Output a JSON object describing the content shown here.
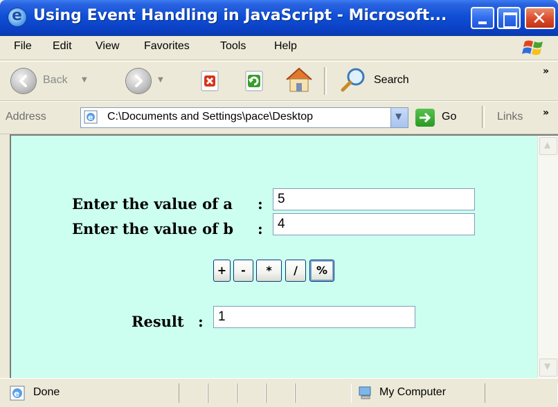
{
  "window": {
    "title": "Using Event Handling in JavaScript - Microsoft...",
    "title_bar_color": "#0a46d6"
  },
  "menu": {
    "file": "File",
    "edit": "Edit",
    "view": "View",
    "favorites": "Favorites",
    "tools": "Tools",
    "help": "Help"
  },
  "toolbar": {
    "back_label": "Back",
    "search_label": "Search",
    "more": "»"
  },
  "address": {
    "label": "Address",
    "value": "C:\\Documents and Settings\\pace\\Desktop",
    "go_label": "Go",
    "links_label": "Links",
    "more": "»"
  },
  "page": {
    "background": "#ccfff0",
    "label_a": "Enter the value of a",
    "label_b": "Enter the value of b",
    "colon": ":",
    "value_a": "5",
    "value_b": "4",
    "operators": [
      "+",
      "-",
      "*",
      "/",
      "%"
    ],
    "result_label": "Result",
    "result_value": "1"
  },
  "status": {
    "text": "Done",
    "zone": "My Computer"
  }
}
